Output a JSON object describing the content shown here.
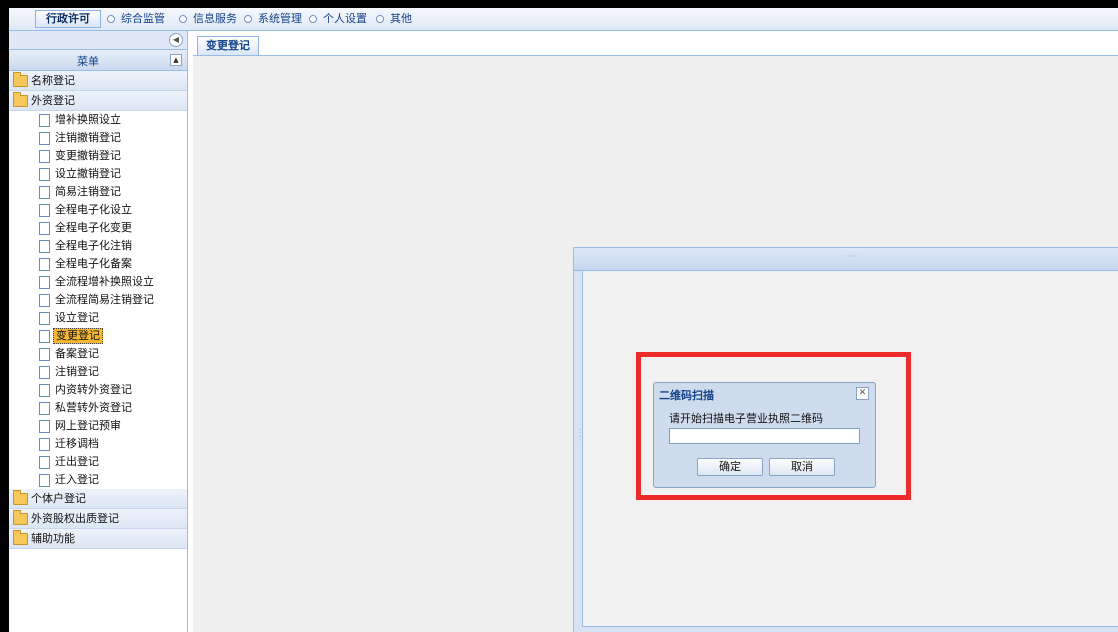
{
  "topbar": {
    "active": "行政许可",
    "items": [
      "综合监管",
      "信息服务",
      "系统管理",
      "个人设置",
      "其他"
    ]
  },
  "west": {
    "menu_title": "菜单",
    "groups": [
      {
        "label": "名称登记"
      },
      {
        "label": "外资登记",
        "children": [
          "增补换照设立",
          "注销撤销登记",
          "变更撤销登记",
          "设立撤销登记",
          "简易注销登记",
          "全程电子化设立",
          "全程电子化变更",
          "全程电子化注销",
          "全程电子化备案",
          "全流程增补换照设立",
          "全流程简易注销登记",
          "设立登记",
          "变更登记",
          "备案登记",
          "注销登记",
          "内资转外资登记",
          "私营转外资登记",
          "网上登记预审",
          "迁移调档",
          "迁出登记",
          "迁入登记"
        ]
      },
      {
        "label": "个体户登记"
      },
      {
        "label": "外资股权出质登记"
      },
      {
        "label": "辅助功能"
      }
    ],
    "selected": "变更登记"
  },
  "center": {
    "tab_label": "变更登记"
  },
  "dialog": {
    "title": "二维码扫描",
    "prompt": "请开始扫描电子营业执照二维码",
    "input_value": "",
    "ok_label": "确定",
    "cancel_label": "取消"
  },
  "colors": {
    "highlight_border": "#ee2b2b",
    "selected_item": "#f7b733"
  }
}
